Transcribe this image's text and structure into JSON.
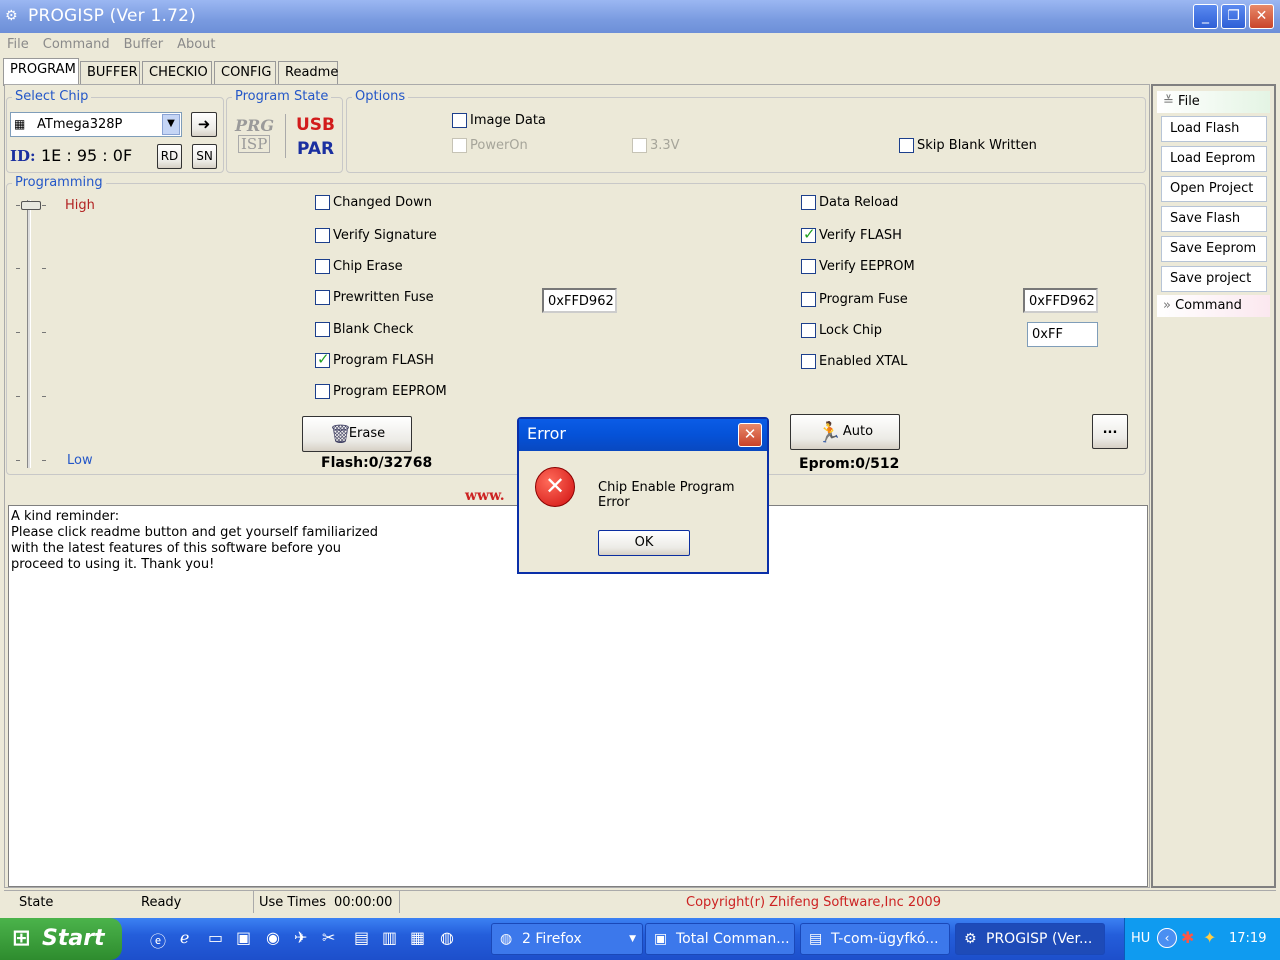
{
  "window": {
    "title": "PROGISP (Ver 1.72)"
  },
  "menu": [
    "File",
    "Command",
    "Buffer",
    "About"
  ],
  "tabs": [
    "PROGRAM",
    "BUFFER",
    "CHECKIO",
    "CONFIG",
    "Readme"
  ],
  "select_chip": {
    "label": "Select Chip",
    "chip": "ATmega328P",
    "id_label": "ID:",
    "id_value": "1E : 95 : 0F",
    "rd": "RD",
    "sn": "SN"
  },
  "program_state": {
    "label": "Program State",
    "prg": "PRG",
    "isp": "ISP",
    "usb": "USB",
    "par": "PAR"
  },
  "options": {
    "label": "Options",
    "image_data": "Image Data",
    "power_on": "PowerOn",
    "v33": "3.3V",
    "skip_blank": "Skip Blank Written"
  },
  "programming": {
    "label": "Programming",
    "high": "High",
    "low": "Low",
    "left": [
      {
        "label": "Changed Down",
        "checked": false
      },
      {
        "label": "Verify Signature",
        "checked": false
      },
      {
        "label": "Chip Erase",
        "checked": false
      },
      {
        "label": "Prewritten Fuse",
        "checked": false
      },
      {
        "label": "Blank Check",
        "checked": false
      },
      {
        "label": "Program FLASH",
        "checked": true
      },
      {
        "label": "Program EEPROM",
        "checked": false
      }
    ],
    "right": [
      {
        "label": "Data Reload",
        "checked": false
      },
      {
        "label": "Verify FLASH",
        "checked": true
      },
      {
        "label": "Verify EEPROM",
        "checked": false
      },
      {
        "label": "Program Fuse",
        "checked": false
      },
      {
        "label": "Lock Chip",
        "checked": false
      },
      {
        "label": "Enabled XTAL",
        "checked": false
      }
    ],
    "prewritten_fuse_value": "0xFFD962",
    "program_fuse_value": "0xFFD962",
    "lock_value": "0xFF",
    "erase_button": "Erase",
    "auto_button": "Auto",
    "more_button": "...",
    "flash_info": "Flash:0/32768",
    "eprom_info": "Eprom:0/512",
    "website_fragment": "www."
  },
  "log_text": [
    "A kind reminder:",
    "Please click readme button and get yourself familiarized",
    "with the latest features of this software before you",
    "proceed to using it. Thank you!"
  ],
  "side": {
    "file_header": "File",
    "buttons": [
      "Load Flash",
      "Load Eeprom",
      "Open Project",
      "Save Flash",
      "Save Eeprom",
      "Save project"
    ],
    "command_header": "Command"
  },
  "status": {
    "state_label": "State",
    "state_value": "Ready",
    "use_times_label": "Use Times",
    "use_times_value": "00:00:00",
    "copyright": "Copyright(r) Zhifeng Software,Inc 2009"
  },
  "dialog": {
    "title": "Error",
    "message": "Chip Enable Program Error",
    "ok": "OK"
  },
  "taskbar": {
    "start": "Start",
    "tasks": [
      "2 Firefox",
      "Total Comman...",
      "T-com-ügyfkó...",
      "PROGISP (Ver..."
    ],
    "lang": "HU",
    "clock": "17:19"
  },
  "colors": {
    "title_blue": "#7a9be0",
    "group_label": "#2457c8",
    "high_low": "#b22222",
    "copyright": "#cc2222",
    "dialog_title": "#0552d8",
    "taskbar": "#245edb",
    "start": "#3a9e3a"
  }
}
